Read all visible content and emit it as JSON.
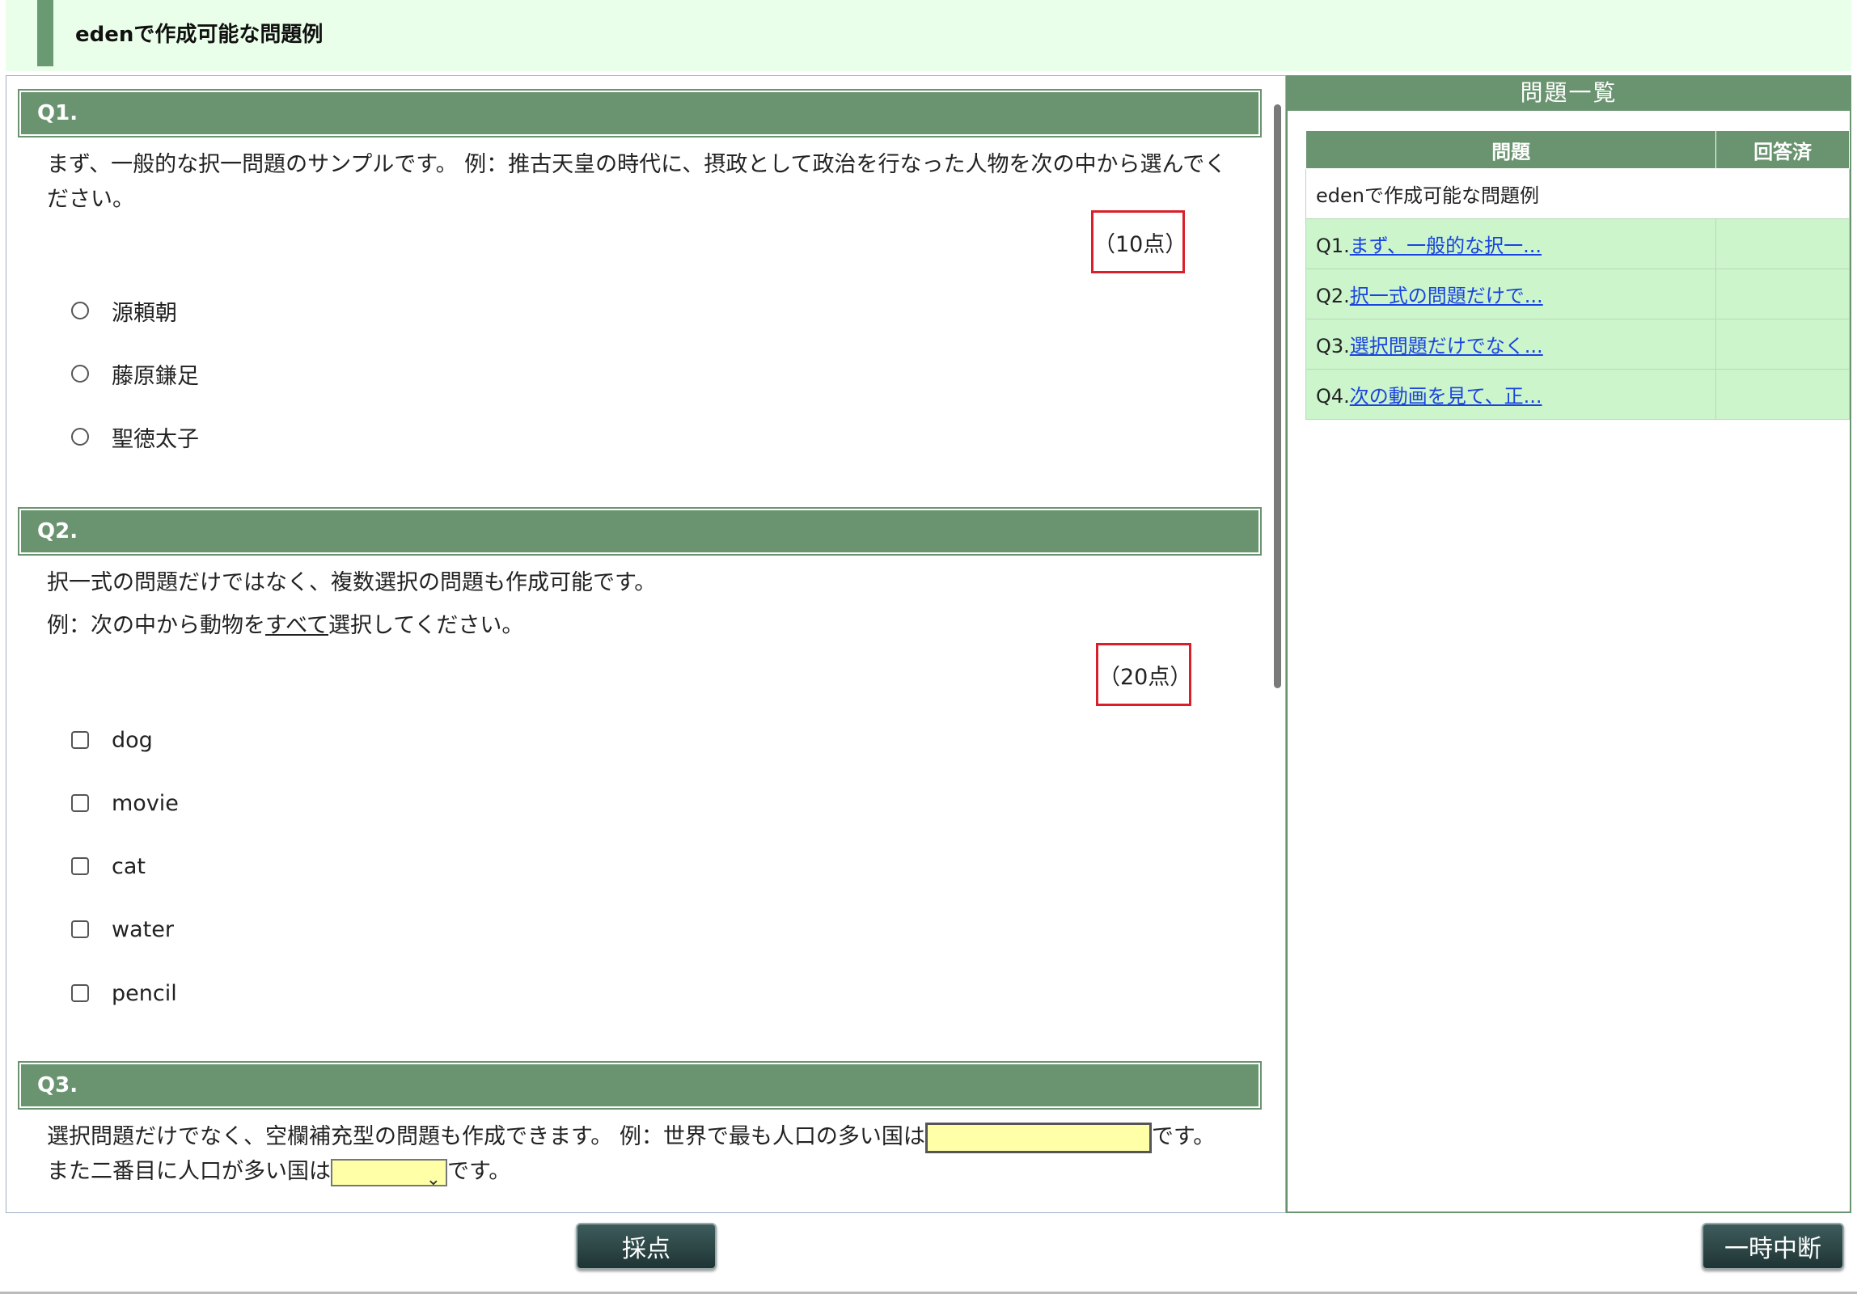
{
  "page": {
    "title": "edenで作成可能な問題例"
  },
  "questions": [
    {
      "label": "Q1.",
      "text": "まず、一般的な択一問題のサンプルです。 例：推古天皇の時代に、摂政として政治を行なった人物を次の中から選んでください。",
      "points": "（10点）",
      "options": [
        "源頼朝",
        "藤原鎌足",
        "聖徳太子"
      ]
    },
    {
      "label": "Q2.",
      "text1": "択一式の問題だけではなく、複数選択の問題も作成可能です。",
      "text2a": "例：次の中から動物を",
      "text2b": "すべて",
      "text2c": "選択してください。",
      "points": "（20点）",
      "options": [
        "dog",
        "movie",
        "cat",
        "water",
        "pencil"
      ]
    },
    {
      "label": "Q3.",
      "text_a": "選択問題だけでなく、空欄補充型の問題も作成できます。 例：世界で最も人口の多い国は",
      "text_b": "です。また二番目に人口が多い国は",
      "text_c": "です。"
    }
  ],
  "panel": {
    "title": "問題一覧",
    "col_question": "問題",
    "col_answered": "回答済",
    "section": "edenで作成可能な問題例",
    "rows": [
      {
        "num": "Q1.",
        "link": "まず、一般的な択一..."
      },
      {
        "num": "Q2.",
        "link": "択一式の問題だけで..."
      },
      {
        "num": "Q3.",
        "link": "選択問題だけでなく..."
      },
      {
        "num": "Q4.",
        "link": "次の動画を見て、正..."
      }
    ]
  },
  "buttons": {
    "grade": "採点",
    "pause": "一時中断"
  },
  "colors": {
    "header_green": "#6a9470",
    "title_bg": "#eaffea",
    "row_green": "#ccf5cc",
    "points_border": "#d9202a",
    "blank_fill": "#ffffa8"
  }
}
